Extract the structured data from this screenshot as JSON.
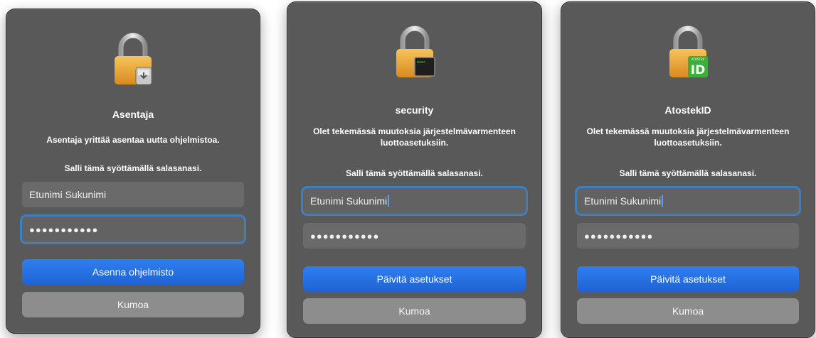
{
  "dialogs": [
    {
      "title": "Asentaja",
      "message": "Asentaja yrittää asentaa uutta ohjelmistoa.",
      "prompt": "Salli tämä syöttämällä salasanasi.",
      "username": "Etunimi Sukunimi",
      "password_mask": "●●●●●●●●●●●",
      "primary_label": "Asenna ohjelmisto",
      "cancel_label": "Kumoa",
      "badge_icon": "installer-badge-icon"
    },
    {
      "title": "security",
      "message": "Olet tekemässä muutoksia järjestelmävarmenteen luottoasetuksiin.",
      "prompt": "Salli tämä syöttämällä salasanasi.",
      "username": "Etunimi Sukunimi",
      "password_mask": "●●●●●●●●●●●",
      "primary_label": "Päivitä asetukset",
      "cancel_label": "Kumoa",
      "badge_icon": "terminal-badge-icon",
      "badge_text": "exec"
    },
    {
      "title": "AtostekID",
      "message": "Olet tekemässä muutoksia järjestelmävarmenteen luottoasetuksiin.",
      "prompt": "Salli tämä syöttämällä salasanasi.",
      "username": "Etunimi Sukunimi",
      "password_mask": "●●●●●●●●●●●",
      "primary_label": "Päivitä asetukset",
      "cancel_label": "Kumoa",
      "badge_icon": "atostek-id-badge-icon",
      "badge_text": "ID",
      "badge_caption": "ATOSTEK"
    }
  ],
  "colors": {
    "dialog_bg": "#595959",
    "primary_button": "#2a72e6",
    "secondary_button": "#8d8d8d",
    "focus_ring": "#3f7fc0",
    "lock_gold": "#e8a43a",
    "badge_green": "#3cae3c"
  }
}
